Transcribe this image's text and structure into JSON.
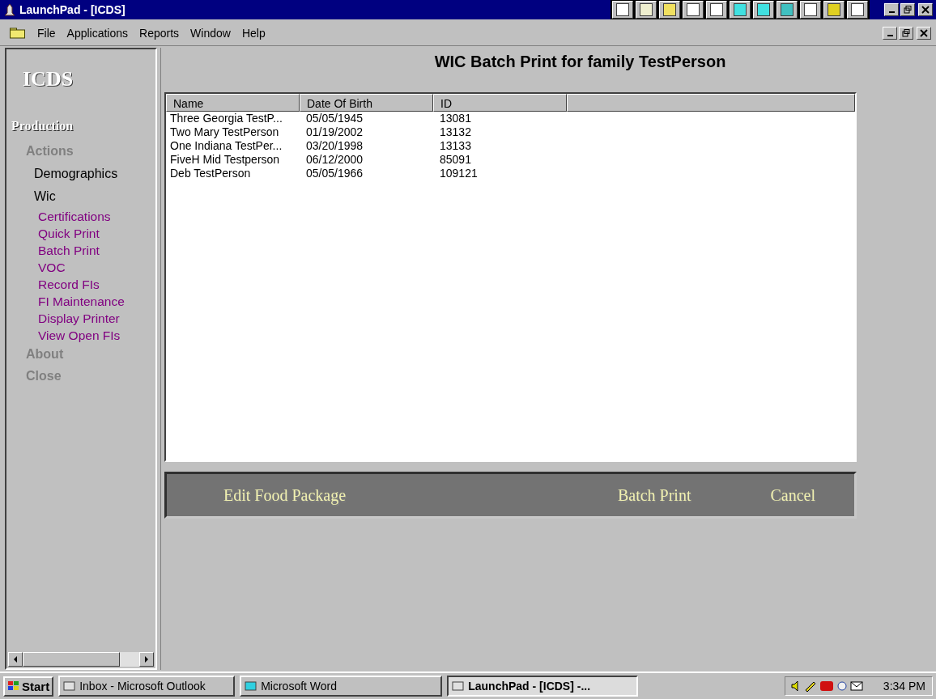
{
  "window": {
    "title": "LaunchPad - [ICDS]"
  },
  "menu": [
    {
      "label": "File"
    },
    {
      "label": "Applications"
    },
    {
      "label": "Reports"
    },
    {
      "label": "Window"
    },
    {
      "label": "Help"
    }
  ],
  "sidebar": {
    "logo": "ICDS",
    "items": [
      {
        "kind": "heading",
        "label": "Production"
      },
      {
        "kind": "section",
        "label": "Actions"
      },
      {
        "kind": "item",
        "label": "Demographics"
      },
      {
        "kind": "item",
        "label": "Wic"
      },
      {
        "kind": "link",
        "label": "Certifications"
      },
      {
        "kind": "link",
        "label": "Quick Print"
      },
      {
        "kind": "link",
        "label": "Batch Print"
      },
      {
        "kind": "link",
        "label": "VOC"
      },
      {
        "kind": "link",
        "label": "Record FIs"
      },
      {
        "kind": "link",
        "label": "FI Maintenance"
      },
      {
        "kind": "link",
        "label": "Display Printer"
      },
      {
        "kind": "link",
        "label": "View Open FIs"
      },
      {
        "kind": "section",
        "label": "About"
      },
      {
        "kind": "section",
        "label": "Close"
      }
    ]
  },
  "page": {
    "title": "WIC Batch Print for family TestPerson"
  },
  "table": {
    "columns": [
      "Name",
      "Date Of Birth",
      "ID"
    ],
    "rows": [
      [
        "Three Georgia TestP...",
        "05/05/1945",
        "13081"
      ],
      [
        "Two Mary TestPerson",
        "01/19/2002",
        "13132"
      ],
      [
        "One Indiana TestPer...",
        "03/20/1998",
        "13133"
      ],
      [
        "FiveH Mid Testperson",
        "06/12/2000",
        "85091"
      ],
      [
        "Deb TestPerson",
        "05/05/1966",
        "109121"
      ]
    ]
  },
  "actions": [
    {
      "label": "Edit Food Package"
    },
    {
      "label": "Batch Print"
    },
    {
      "label": "Cancel"
    }
  ],
  "taskbar": {
    "start": "Start",
    "tasks": [
      {
        "label": "Inbox - Microsoft Outlook",
        "selected": false
      },
      {
        "label": "Microsoft Word",
        "selected": false
      },
      {
        "label": "LaunchPad - [ICDS] -...",
        "selected": true
      }
    ],
    "clock": "3:34 PM"
  }
}
